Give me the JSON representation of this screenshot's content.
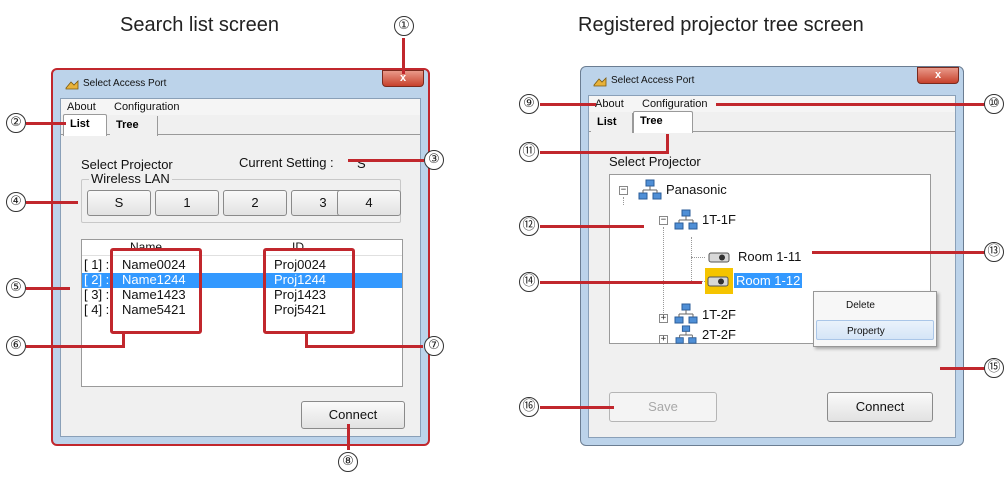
{
  "captions": {
    "left": "Search list screen",
    "right": "Registered projector tree screen"
  },
  "callouts": [
    "①",
    "②",
    "③",
    "④",
    "⑤",
    "⑥",
    "⑦",
    "⑧",
    "⑨",
    "⑩",
    "⑪",
    "⑫",
    "⑬",
    "⑭",
    "⑮",
    "⑯"
  ],
  "window": {
    "title": "Select Access Port",
    "close_label": "x",
    "menu": {
      "about": "About",
      "configuration": "Configuration"
    },
    "tabs": {
      "list": "List",
      "tree": "Tree"
    }
  },
  "list_screen": {
    "select_projector": "Select Projector",
    "current_setting_label": "Current Setting :",
    "current_setting_value": "S",
    "wireless_lan_label": "Wireless LAN",
    "wireless_buttons": [
      "S",
      "1",
      "2",
      "3",
      "4"
    ],
    "columns": {
      "name": "Name",
      "id": "ID"
    },
    "rows": [
      {
        "index": "[ 1] :",
        "name": "Name0024",
        "id": "Proj0024",
        "selected": false
      },
      {
        "index": "[ 2] :",
        "name": "Name1244",
        "id": "Proj1244",
        "selected": true
      },
      {
        "index": "[ 3] :",
        "name": "Name1423",
        "id": "Proj1423",
        "selected": false
      },
      {
        "index": "[ 4] :",
        "name": "Name5421",
        "id": "Proj5421",
        "selected": false
      }
    ],
    "connect_label": "Connect"
  },
  "tree_screen": {
    "select_projector": "Select Projector",
    "nodes": {
      "root": "Panasonic",
      "floor1": "1T-1F",
      "room11": "Room 1-11",
      "room12": "Room 1-12",
      "floor2": "1T-2F",
      "floor3": "2T-2F"
    },
    "context_menu": {
      "delete": "Delete",
      "property": "Property"
    },
    "save_label": "Save",
    "connect_label": "Connect"
  },
  "colors": {
    "callout_line": "#c1272d",
    "selection": "#3399ff",
    "highlight_icon": "#f5c400"
  }
}
